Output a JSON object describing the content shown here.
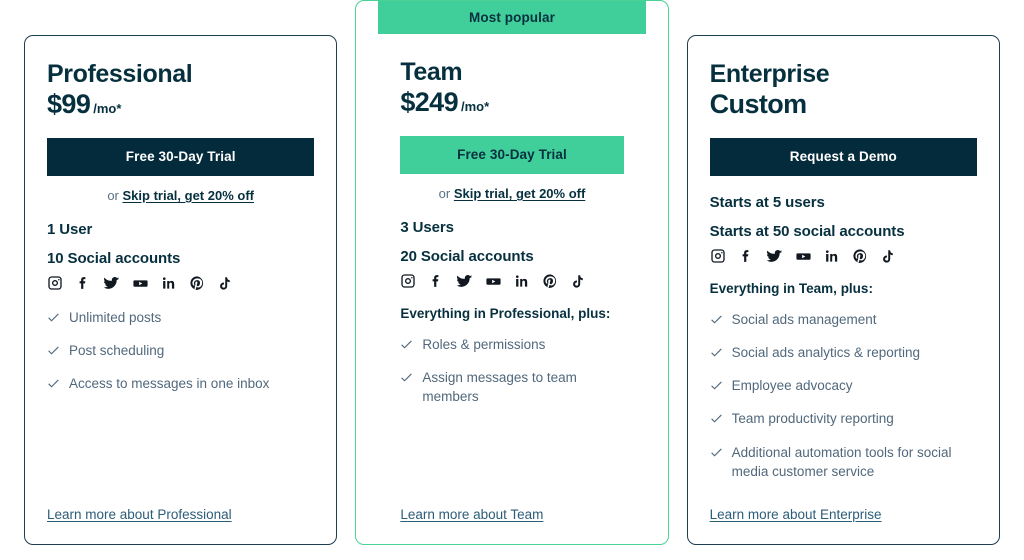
{
  "colors": {
    "navy": "#042b3b",
    "green": "#40cf9a",
    "text_muted": "#51687c",
    "link": "#2c5d78"
  },
  "social_icons": [
    "instagram-icon",
    "facebook-icon",
    "twitter-icon",
    "youtube-icon",
    "linkedin-icon",
    "pinterest-icon",
    "tiktok-icon"
  ],
  "plans": [
    {
      "name": "Professional",
      "price": "$99",
      "price_unit": "/mo*",
      "cta_label": "Free 30-Day Trial",
      "trial_prefix": "or ",
      "trial_link": "Skip trial, get 20% off",
      "users": "1 User",
      "accounts": "10 Social accounts",
      "plus_label": "",
      "features": [
        "Unlimited posts",
        "Post scheduling",
        "Access to messages in one inbox"
      ],
      "learn_more": "Learn more about Professional"
    },
    {
      "name": "Team",
      "ribbon": "Most popular",
      "price": "$249",
      "price_unit": "/mo*",
      "cta_label": "Free 30-Day Trial",
      "trial_prefix": "or ",
      "trial_link": "Skip trial, get 20% off",
      "users": "3 Users",
      "accounts": "20 Social accounts",
      "plus_label": "Everything in Professional, plus:",
      "features": [
        "Roles & permissions",
        "Assign messages to team members"
      ],
      "learn_more": "Learn more about Team"
    },
    {
      "name": "Enterprise",
      "price": "Custom",
      "price_unit": "",
      "cta_label": "Request a Demo",
      "users": "Starts at 5 users",
      "accounts": "Starts at 50 social accounts",
      "plus_label": "Everything in Team, plus:",
      "features": [
        "Social ads management",
        "Social ads analytics & reporting",
        "Employee advocacy",
        "Team productivity reporting",
        "Additional automation tools for social media customer service"
      ],
      "learn_more": "Learn more about Enterprise"
    }
  ]
}
